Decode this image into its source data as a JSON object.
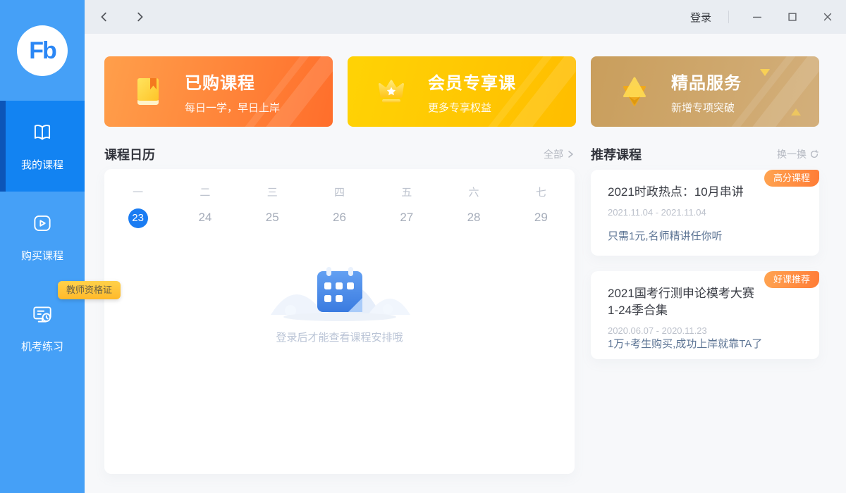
{
  "titlebar": {
    "login_label": "登录"
  },
  "sidebar": {
    "logo_text": "Fb",
    "items": [
      {
        "label": "我的课程",
        "icon": "open-book-icon",
        "active": true
      },
      {
        "label": "购买课程",
        "icon": "play-video-icon",
        "active": false
      },
      {
        "label": "机考练习",
        "icon": "computer-exam-icon",
        "active": false
      }
    ],
    "tooltip_label": "教师资格证"
  },
  "banners": [
    {
      "title": "已购课程",
      "subtitle": "每日一学，早日上岸",
      "icon": "book-icon",
      "color_from": "#FF9F4B",
      "color_to": "#FF6E2B"
    },
    {
      "title": "会员专享课",
      "subtitle": "更多专享权益",
      "icon": "crown-icon",
      "color_from": "#FFD305",
      "color_to": "#FFBD00"
    },
    {
      "title": "精品服务",
      "subtitle": "新增专项突破",
      "icon": "gem-star-icon",
      "color_from": "#C99E5C",
      "color_to": "#D3AF7B"
    }
  ],
  "calendar": {
    "title": "课程日历",
    "all_label": "全部",
    "weekdays": [
      "一",
      "二",
      "三",
      "四",
      "五",
      "六",
      "七"
    ],
    "dates": [
      "23",
      "24",
      "25",
      "26",
      "27",
      "28",
      "29"
    ],
    "selected_date": "23",
    "empty_text": "登录后才能查看课程安排哦"
  },
  "recommend": {
    "title": "推荐课程",
    "refresh_label": "换一换",
    "cards": [
      {
        "badge": "高分课程",
        "title": "2021时政热点：10月串讲",
        "date_range": "2021.11.04 - 2021.11.04",
        "desc": "只需1元,名师精讲任你听"
      },
      {
        "badge": "好课推荐",
        "title": "2021国考行测申论模考大赛\n1-24季合集",
        "date_range": "2020.06.07 - 2020.11.23",
        "desc": "1万+考生购买,成功上岸就靠TA了"
      }
    ]
  },
  "colors": {
    "sidebar_blue": "#45A0F7",
    "sidebar_active_blue": "#1283F2",
    "sidebar_active_strip": "#0C55B8",
    "accent_blue": "#1A7CF2",
    "badge_orange": "#FF8A42",
    "tooltip_yellow": "#FFC53D",
    "titlebar_gray": "#E9EDF2",
    "content_bg": "#F7F8FA"
  }
}
